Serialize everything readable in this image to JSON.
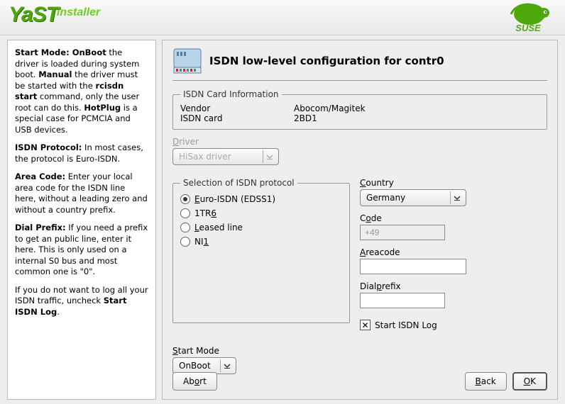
{
  "header": {
    "logo_yast": "YaST",
    "logo_installer": "installer",
    "suse": "SUSE"
  },
  "help": {
    "p1_b": "Start Mode: OnBoot",
    "p1_r": " the driver is loaded during system boot. ",
    "p1_b2": "Manual",
    "p1_r2": " the driver must be started with the ",
    "p1_b3": "rcisdn start",
    "p1_r3": " command, only the user root can do this. ",
    "p1_b4": "HotPlug",
    "p1_r4": " is a special case for PCMCIA and USB devices.",
    "p2_b": "ISDN Protocol:",
    "p2_r": " In most cases, the protocol is Euro-ISDN.",
    "p3_b": "Area Code:",
    "p3_r": " Enter your local area code for the ISDN line here, without a leading zero and without a country prefix.",
    "p4_b": "Dial Prefix:",
    "p4_r": " If you need a prefix to get an public line, enter it here. This is only used on a internal S0 bus and most common one is \"0\".",
    "p5_r1": "If you do not want to log all your ISDN traffic, uncheck ",
    "p5_b": "Start ISDN Log",
    "p5_r2": "."
  },
  "title": "ISDN low-level configuration for contr0",
  "card": {
    "legend": "ISDN Card Information",
    "vendor_label": "Vendor",
    "vendor_value": "Abocom/Magitek",
    "card_label": "ISDN card",
    "card_value": "2BD1"
  },
  "driver": {
    "label": "Driver",
    "value": "HiSax driver"
  },
  "protocol": {
    "legend": "Selection of ISDN protocol",
    "opts": [
      "Euro-ISDN (EDSS1)",
      "1TR6",
      "Leased line",
      "NI1"
    ],
    "selected": 0
  },
  "country": {
    "label": "Country",
    "value": "Germany"
  },
  "code": {
    "label": "Code",
    "value": "+49"
  },
  "areacode": {
    "label": "Areacode",
    "value": ""
  },
  "dialprefix": {
    "label": "Dialprefix",
    "value": ""
  },
  "startlog": {
    "label": "Start ISDN Log",
    "checked": true
  },
  "startmode": {
    "label": "Start Mode",
    "value": "OnBoot"
  },
  "buttons": {
    "abort": "Abort",
    "back": "Back",
    "ok": "OK"
  }
}
